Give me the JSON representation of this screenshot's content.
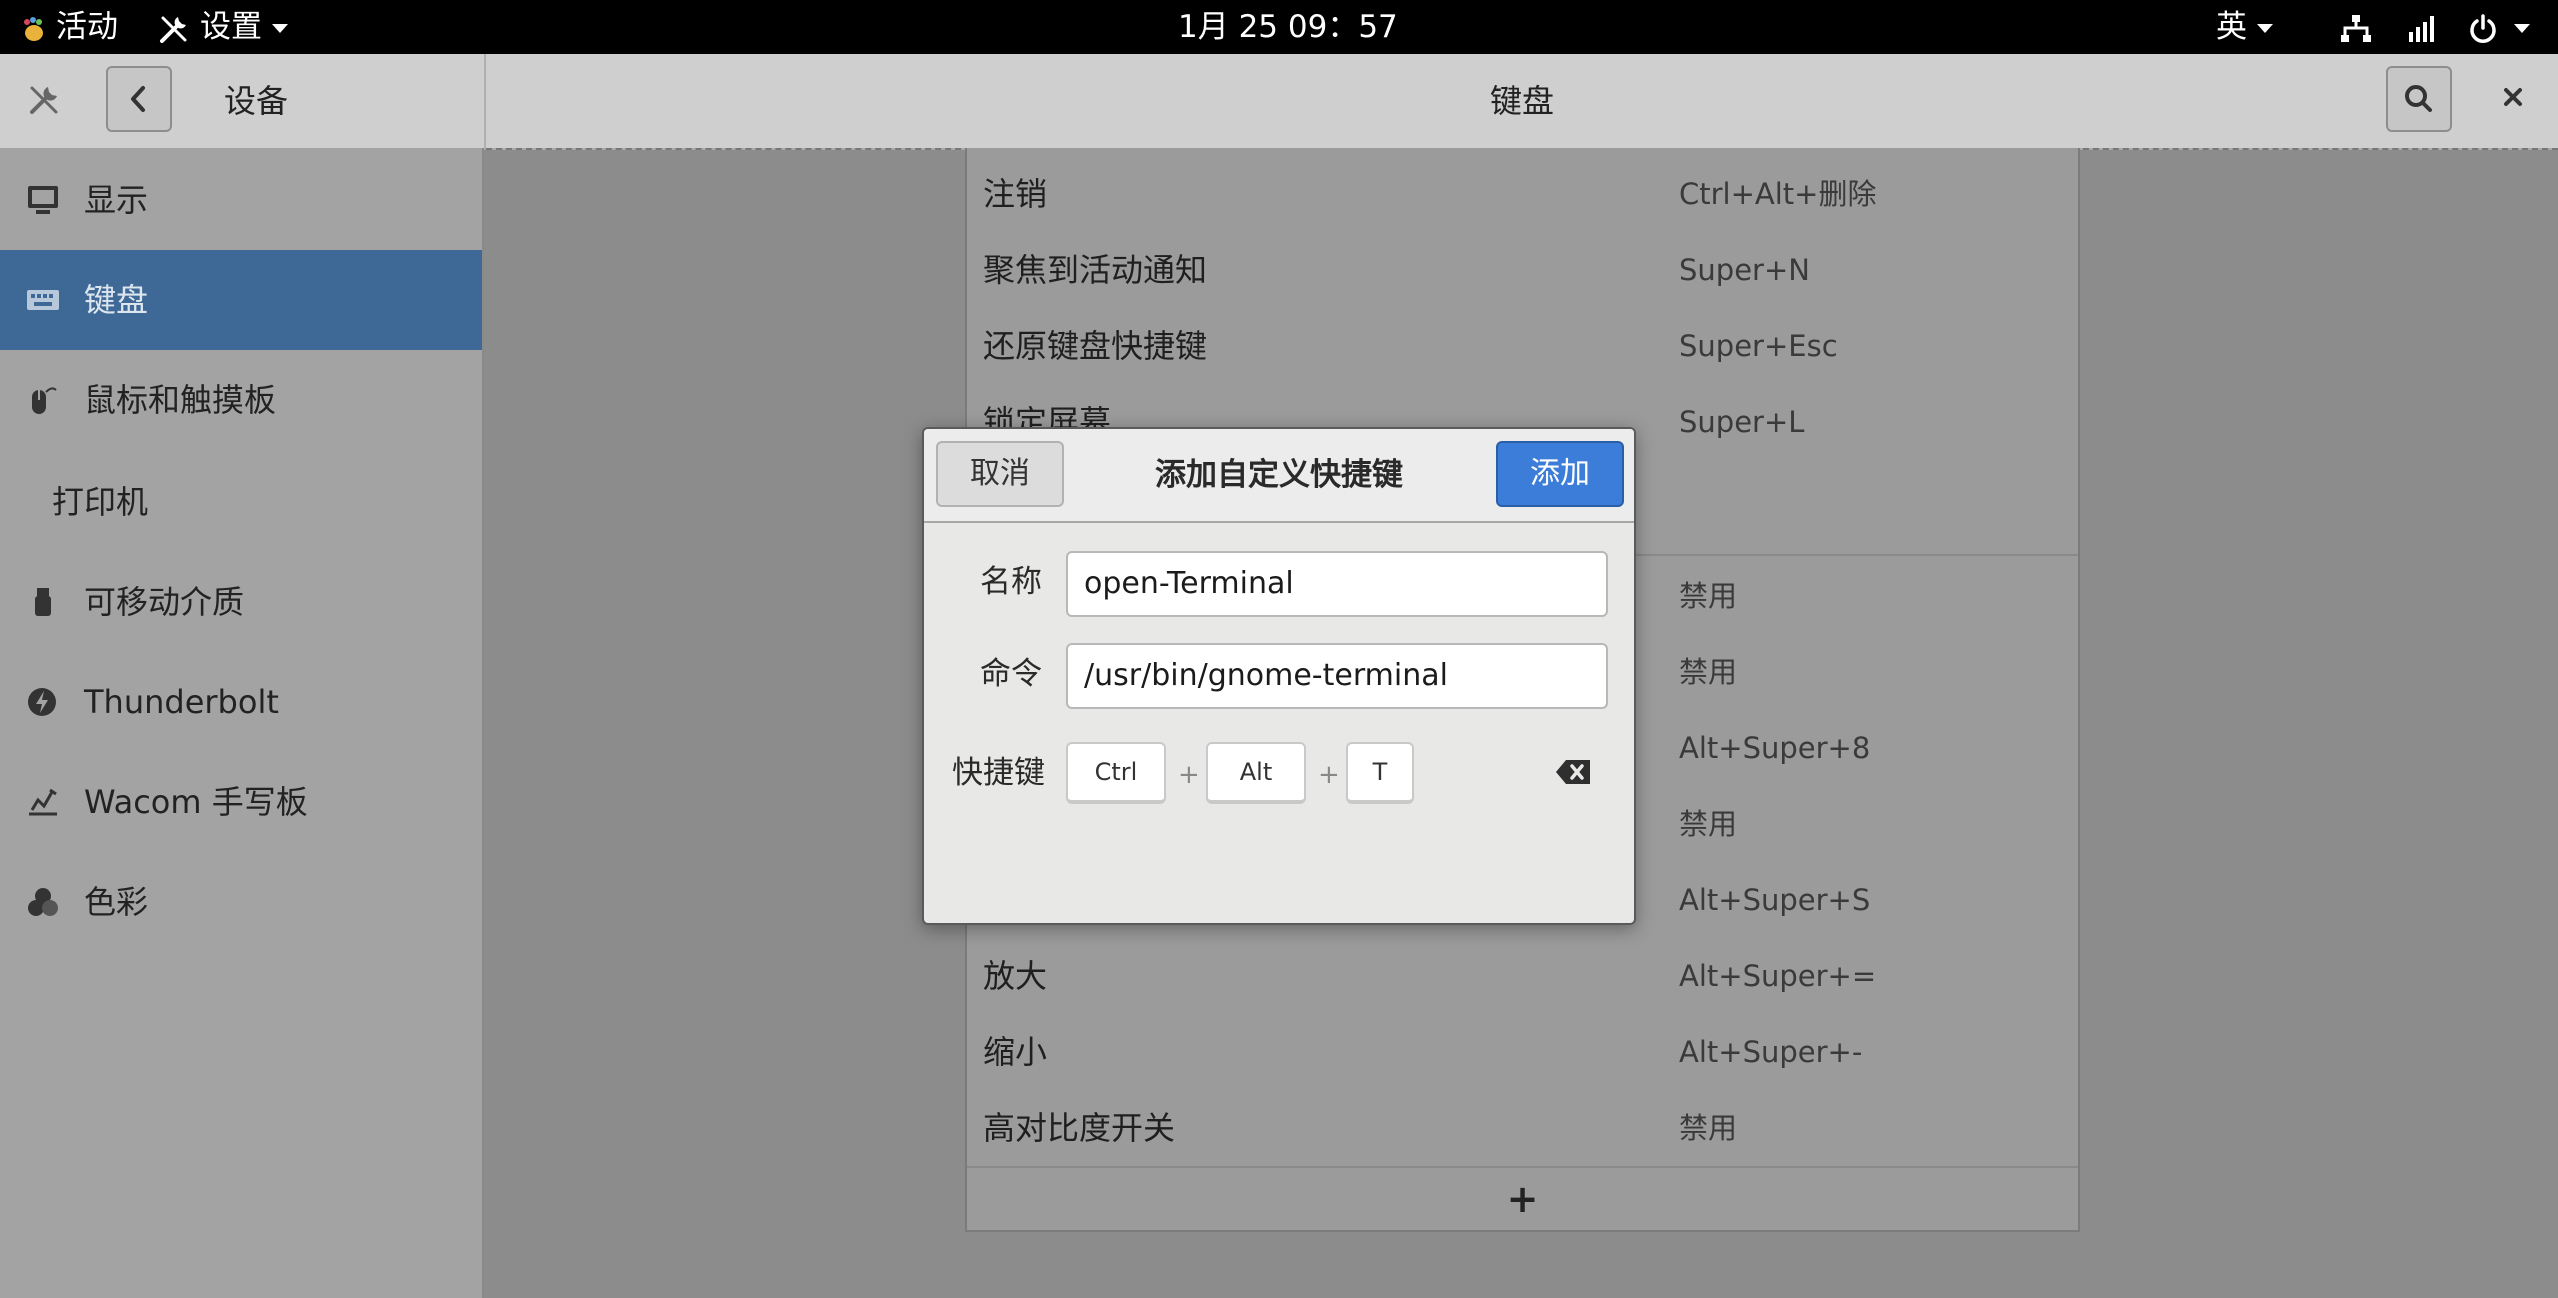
{
  "topbar": {
    "activities": "活动",
    "app_menu": "设置",
    "clock": "1月 25  09：57",
    "input_method": "英"
  },
  "header": {
    "section_title": "设备",
    "page_title": "键盘"
  },
  "sidebar": {
    "items": [
      {
        "label": "显示",
        "icon": "display-icon"
      },
      {
        "label": "键盘",
        "icon": "keyboard-icon",
        "selected": true
      },
      {
        "label": "鼠标和触摸板",
        "icon": "mouse-icon"
      },
      {
        "label": "打印机",
        "icon": ""
      },
      {
        "label": "可移动介质",
        "icon": "usb-drive-icon"
      },
      {
        "label": "Thunderbolt",
        "icon": "thunderbolt-icon"
      },
      {
        "label": "Wacom 手写板",
        "icon": "tablet-icon"
      },
      {
        "label": "色彩",
        "icon": "color-icon"
      }
    ]
  },
  "shortcuts": {
    "rows": [
      {
        "name": "注销",
        "shortcut": "Ctrl+Alt+删除"
      },
      {
        "name": "聚焦到活动通知",
        "shortcut": "Super+N"
      },
      {
        "name": "还原键盘快捷键",
        "shortcut": "Super+Esc"
      },
      {
        "name": "锁定屏幕",
        "shortcut": "Super+L"
      },
      {
        "name": "",
        "shortcut": "禁用"
      },
      {
        "name": "",
        "shortcut": "禁用"
      },
      {
        "name": "",
        "shortcut": "Alt+Super+8"
      },
      {
        "name": "",
        "shortcut": "禁用"
      },
      {
        "name": "",
        "shortcut": "Alt+Super+S"
      },
      {
        "name": "放大",
        "shortcut": "Alt+Super+="
      },
      {
        "name": "缩小",
        "shortcut": "Alt+Super+-"
      },
      {
        "name": "高对比度开关",
        "shortcut": "禁用"
      }
    ],
    "add_label": "+"
  },
  "dialog": {
    "title": "添加自定义快捷键",
    "cancel_label": "取消",
    "add_label": "添加",
    "name_label": "名称",
    "name_value": "open-Terminal",
    "command_label": "命令",
    "command_value": "/usr/bin/gnome-terminal",
    "shortcut_label": "快捷键",
    "keys": [
      "Ctrl",
      "Alt",
      "T"
    ],
    "key_separator": "+"
  },
  "colors": {
    "accent": "#3b7dd8",
    "selected_row": "#3e6896",
    "topbar": "#000000"
  }
}
